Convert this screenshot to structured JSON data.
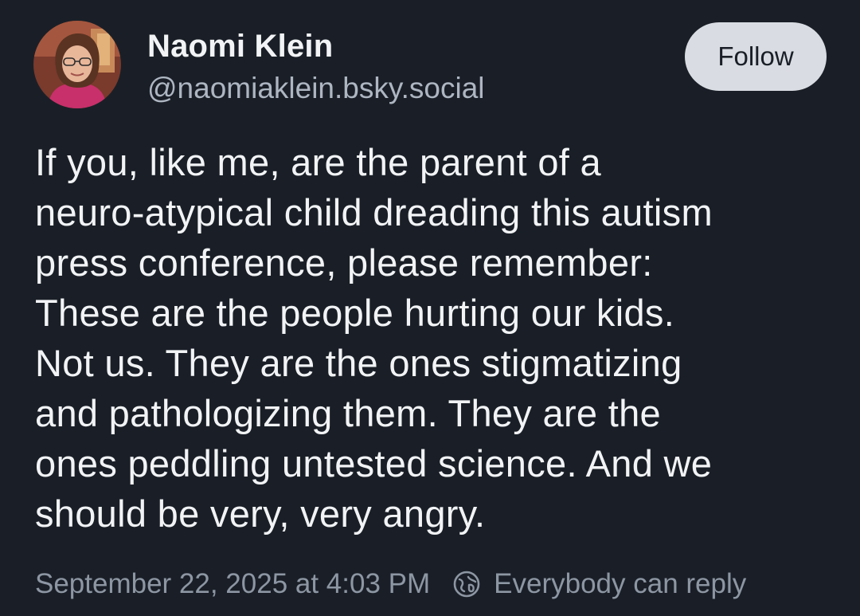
{
  "author": {
    "name": "Naomi Klein",
    "handle": "@naomiaklein.bsky.social",
    "avatar_icon": "profile-photo"
  },
  "follow_button": {
    "label": "Follow"
  },
  "post": {
    "text_lines": [
      "If you, like me, are the parent of a",
      "neuro-atypical child dreading this autism",
      "press conference, please remember:",
      "These are the people hurting our kids.",
      "Not us. They are the ones stigmatizing",
      "and pathologizing them. They are the",
      "ones peddling untested science. And we",
      "should be very, very angry."
    ]
  },
  "meta": {
    "timestamp": "September 22, 2025 at 4:03 PM",
    "reply_icon": "globe-icon",
    "reply_setting": "Everybody can reply"
  },
  "colors": {
    "background": "#1a1f27",
    "text_primary": "#f1f3f5",
    "text_secondary": "#aeb6c2",
    "text_muted": "#8d96a3",
    "button_bg": "#d9dde3"
  }
}
